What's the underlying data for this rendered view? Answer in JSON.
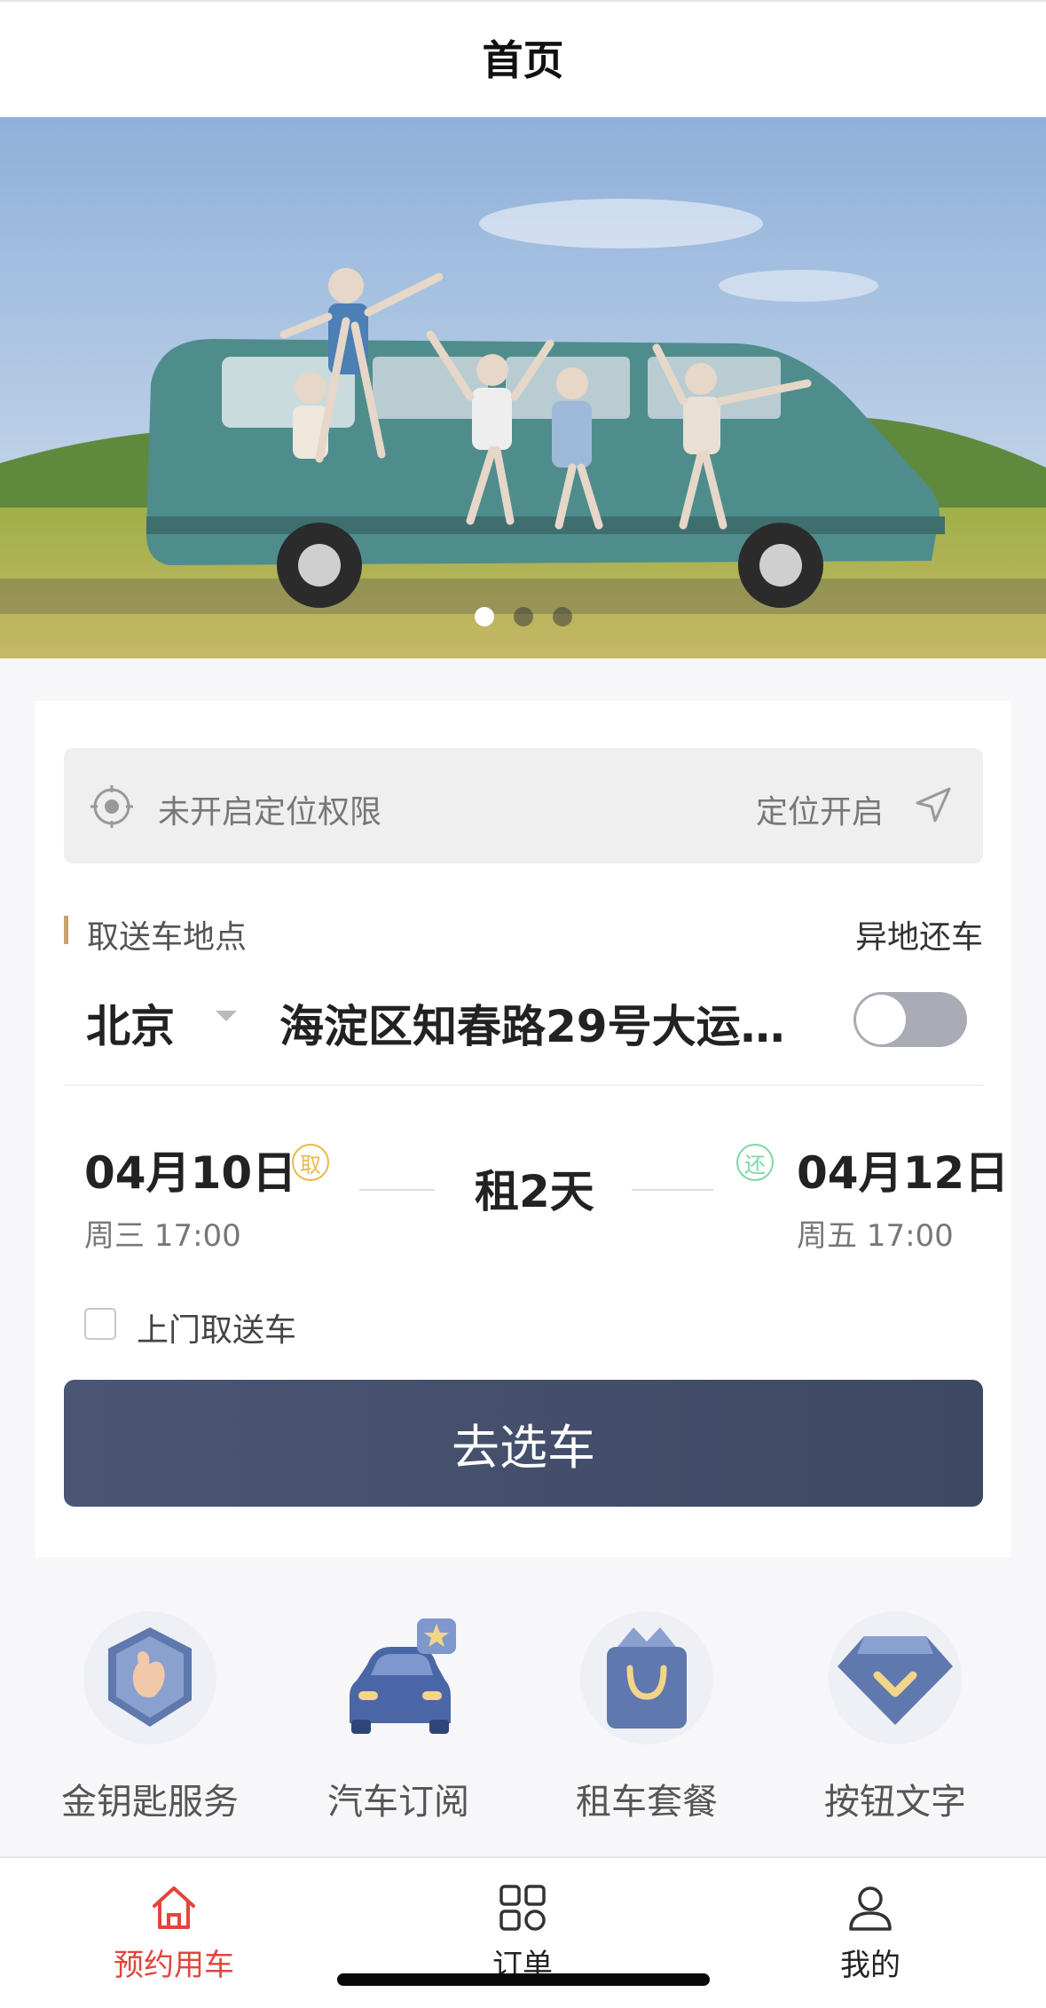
{
  "header": {
    "title": "首页"
  },
  "banner": {
    "slides": 3,
    "active_index": 0
  },
  "location": {
    "message": "未开启定位权限",
    "open_label": "定位开启"
  },
  "pickup": {
    "section_label": "取送车地点",
    "return_elsewhere_label": "异地还车",
    "city": "北京",
    "address": "海淀区知春路29号大运...",
    "return_elsewhere_on": false
  },
  "rental": {
    "start_date": "04月10日",
    "start_tag": "取",
    "start_day": "周三 17:00",
    "duration": "租2天",
    "end_date": "04月12日",
    "end_tag": "还",
    "end_day": "周五 17:00"
  },
  "door_delivery": {
    "label": "上门取送车",
    "checked": false
  },
  "cta": {
    "label": "去选车"
  },
  "services": [
    {
      "label": "金钥匙服务",
      "icon": "golden-key-icon"
    },
    {
      "label": "汽车订阅",
      "icon": "car-subscription-icon"
    },
    {
      "label": "租车套餐",
      "icon": "rental-package-icon"
    },
    {
      "label": "按钮文字",
      "icon": "diamond-icon"
    }
  ],
  "tabbar": {
    "items": [
      {
        "label": "预约用车",
        "icon": "home-icon",
        "active": true
      },
      {
        "label": "订单",
        "icon": "orders-grid-icon",
        "active": false
      },
      {
        "label": "我的",
        "icon": "profile-icon",
        "active": false
      }
    ]
  },
  "colors": {
    "accent_red": "#e0463c",
    "cta_blue": "#46516d",
    "section_bar": "#c8a270",
    "pickup_tag": "#e9b94a",
    "return_tag": "#7dd8a5",
    "icon_blue": "#5a74a8"
  }
}
